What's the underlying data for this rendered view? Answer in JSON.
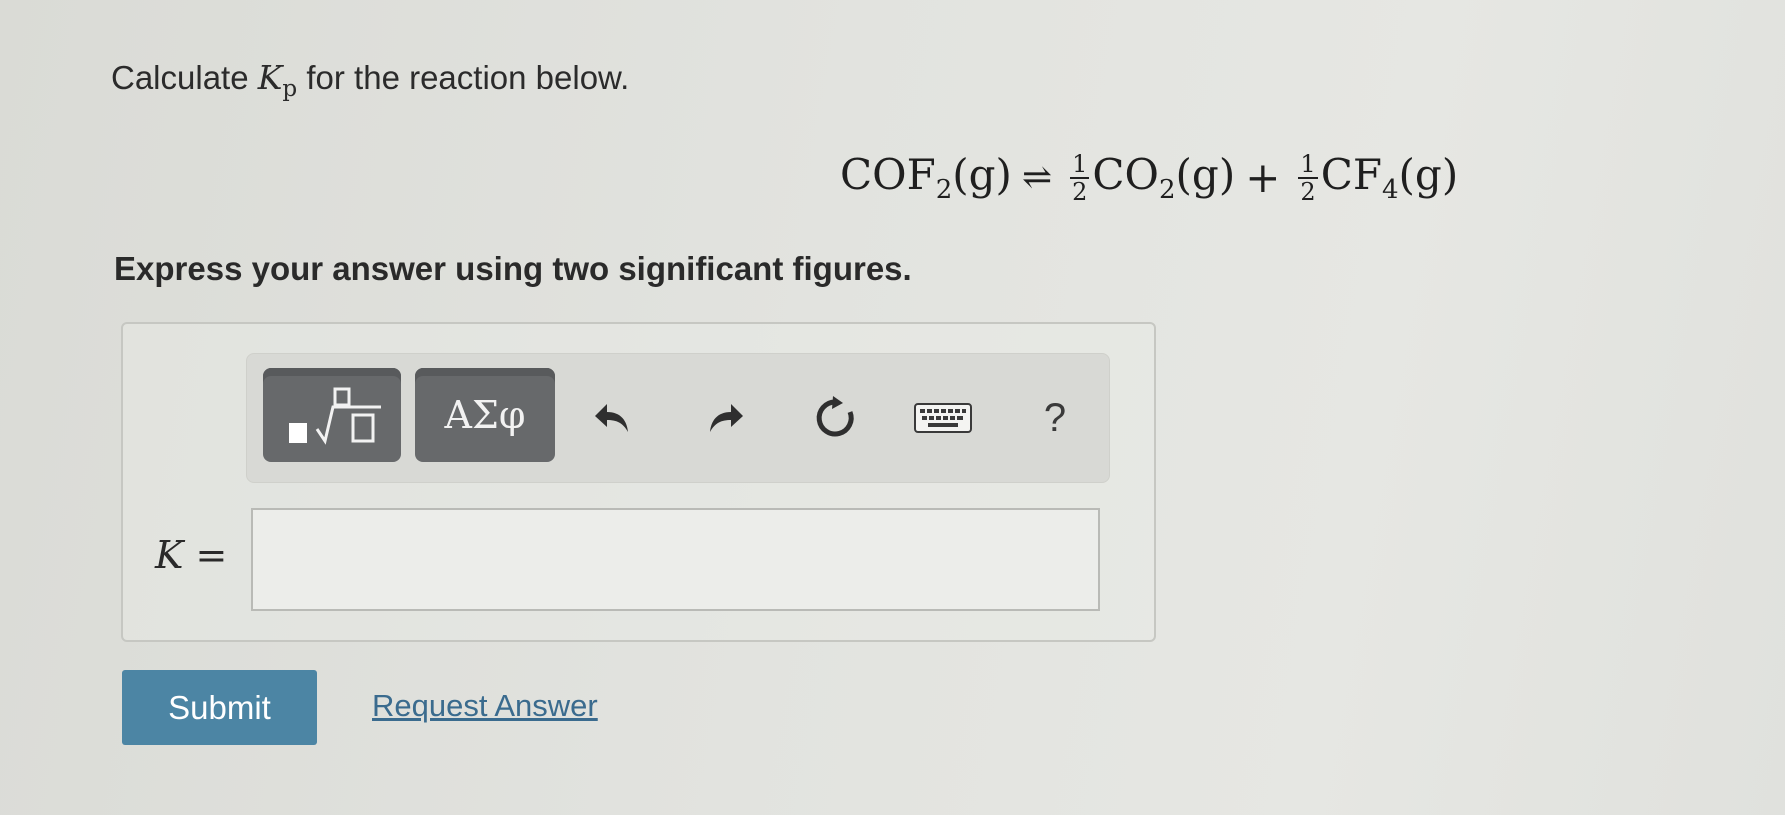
{
  "question": {
    "prefix": "Calculate ",
    "symbol": "K",
    "subscript": "p",
    "suffix": " for the reaction below."
  },
  "equation": {
    "reactant": "COF",
    "reactant_sub": "2",
    "reactant_state": "(g)",
    "arrow": "⇌",
    "coef1_num": "1",
    "coef1_den": "2",
    "product1": "CO",
    "product1_sub": "2",
    "product1_state": "(g)",
    "plus": "+",
    "coef2_num": "1",
    "coef2_den": "2",
    "product2": "CF",
    "product2_sub": "4",
    "product2_state": "(g)"
  },
  "instruction": "Express your answer using two significant figures.",
  "toolbar": {
    "symbols_label": "ΑΣφ",
    "help_label": "?",
    "icons": [
      "templates-icon",
      "undo-icon",
      "redo-icon",
      "reset-icon",
      "keyboard-icon",
      "help-icon"
    ]
  },
  "answer": {
    "label_var": "K",
    "label_eq": " =",
    "value": ""
  },
  "actions": {
    "submit_label": "Submit",
    "request_label": "Request Answer"
  },
  "colors": {
    "submit_bg": "#4c85a4",
    "link": "#3a6b8e",
    "tool_button": "#67696b"
  }
}
